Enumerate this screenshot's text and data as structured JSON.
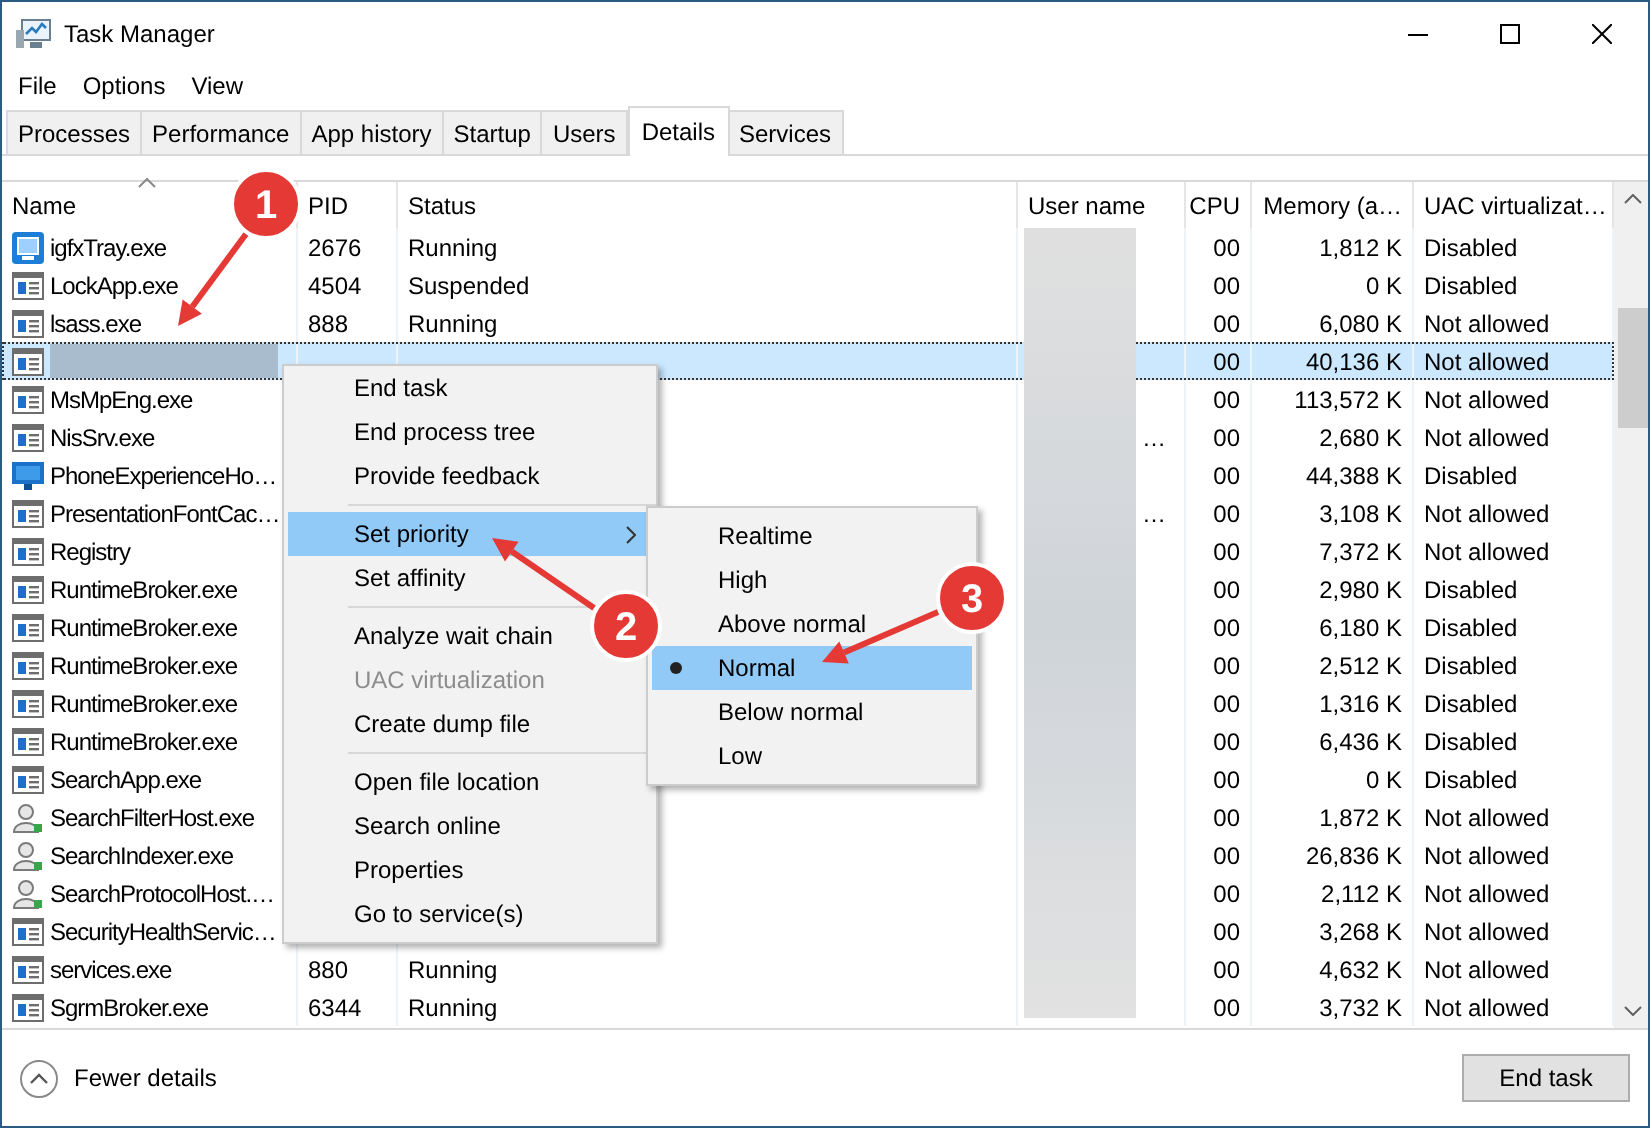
{
  "window": {
    "title": "Task Manager"
  },
  "menu_bar": [
    "File",
    "Options",
    "View"
  ],
  "tabs": [
    {
      "label": "Processes",
      "selected": false
    },
    {
      "label": "Performance",
      "selected": false
    },
    {
      "label": "App history",
      "selected": false
    },
    {
      "label": "Startup",
      "selected": false
    },
    {
      "label": "Users",
      "selected": false
    },
    {
      "label": "Details",
      "selected": true
    },
    {
      "label": "Services",
      "selected": false
    }
  ],
  "table": {
    "columns": [
      "Name",
      "PID",
      "Status",
      "User name",
      "CPU",
      "Memory (a…",
      "UAC virtualizat…"
    ],
    "rows": [
      {
        "kind": "intel",
        "name": "igfxTray.exe",
        "pid": "2676",
        "status": "Running",
        "cpu": "00",
        "memory": "1,812 K",
        "uac": "Disabled",
        "selected": false
      },
      {
        "kind": "app",
        "name": "LockApp.exe",
        "pid": "4504",
        "status": "Suspended",
        "cpu": "00",
        "memory": "0 K",
        "uac": "Disabled",
        "selected": false
      },
      {
        "kind": "app",
        "name": "lsass.exe",
        "pid": "888",
        "status": "Running",
        "cpu": "00",
        "memory": "6,080 K",
        "uac": "Not allowed",
        "selected": false
      },
      {
        "kind": "app",
        "cpu": "00",
        "memory": "40,136 K",
        "uac": "Not allowed",
        "selected": true
      },
      {
        "kind": "app",
        "name": "MsMpEng.exe",
        "cpu": "00",
        "memory": "113,572 K",
        "uac": "Not allowed",
        "selected": false
      },
      {
        "kind": "app",
        "name": "NisSrv.exe",
        "user_name": "…",
        "cpu": "00",
        "memory": "2,680 K",
        "uac": "Not allowed",
        "selected": false
      },
      {
        "kind": "phone",
        "name": "PhoneExperienceHo…",
        "cpu": "00",
        "memory": "44,388 K",
        "uac": "Disabled",
        "selected": false
      },
      {
        "kind": "app",
        "name": "PresentationFontCac…",
        "user_name": "…",
        "cpu": "00",
        "memory": "3,108 K",
        "uac": "Not allowed",
        "selected": false
      },
      {
        "kind": "app",
        "name": "Registry",
        "cpu": "00",
        "memory": "7,372 K",
        "uac": "Not allowed",
        "selected": false
      },
      {
        "kind": "app",
        "name": "RuntimeBroker.exe",
        "cpu": "00",
        "memory": "2,980 K",
        "uac": "Disabled",
        "selected": false
      },
      {
        "kind": "app",
        "name": "RuntimeBroker.exe",
        "cpu": "00",
        "memory": "6,180 K",
        "uac": "Disabled",
        "selected": false
      },
      {
        "kind": "app",
        "name": "RuntimeBroker.exe",
        "cpu": "00",
        "memory": "2,512 K",
        "uac": "Disabled",
        "selected": false
      },
      {
        "kind": "app",
        "name": "RuntimeBroker.exe",
        "cpu": "00",
        "memory": "1,316 K",
        "uac": "Disabled",
        "selected": false
      },
      {
        "kind": "app",
        "name": "RuntimeBroker.exe",
        "cpu": "00",
        "memory": "6,436 K",
        "uac": "Disabled",
        "selected": false
      },
      {
        "kind": "app",
        "name": "SearchApp.exe",
        "cpu": "00",
        "memory": "0 K",
        "uac": "Disabled",
        "selected": false
      },
      {
        "kind": "search",
        "name": "SearchFilterHost.exe",
        "cpu": "00",
        "memory": "1,872 K",
        "uac": "Not allowed",
        "selected": false
      },
      {
        "kind": "search",
        "name": "SearchIndexer.exe",
        "cpu": "00",
        "memory": "26,836 K",
        "uac": "Not allowed",
        "selected": false
      },
      {
        "kind": "search",
        "name": "SearchProtocolHost.…",
        "cpu": "00",
        "memory": "2,112 K",
        "uac": "Not allowed",
        "selected": false
      },
      {
        "kind": "app",
        "name": "SecurityHealthServic…",
        "cpu": "00",
        "memory": "3,268 K",
        "uac": "Not allowed",
        "selected": false
      },
      {
        "kind": "app",
        "name": "services.exe",
        "pid": "880",
        "status": "Running",
        "cpu": "00",
        "memory": "4,632 K",
        "uac": "Not allowed",
        "selected": false
      },
      {
        "kind": "app",
        "name": "SgrmBroker.exe",
        "pid": "6344",
        "status": "Running",
        "cpu": "00",
        "memory": "3,732 K",
        "uac": "Not allowed",
        "selected": false
      }
    ]
  },
  "context_menu": {
    "groups": [
      {
        "items": [
          {
            "label": "End task",
            "selected": false,
            "disabled": false
          },
          {
            "label": "End process tree",
            "selected": false,
            "disabled": false
          },
          {
            "label": "Provide feedback",
            "selected": false,
            "disabled": false
          }
        ]
      },
      {
        "items": [
          {
            "label": "Set priority",
            "selected": true,
            "disabled": false,
            "submenu": true
          },
          {
            "label": "Set affinity",
            "selected": false,
            "disabled": false
          }
        ]
      },
      {
        "items": [
          {
            "label": "Analyze wait chain",
            "selected": false,
            "disabled": false
          },
          {
            "label": "UAC virtualization",
            "selected": false,
            "disabled": true
          },
          {
            "label": "Create dump file",
            "selected": false,
            "disabled": false
          }
        ]
      },
      {
        "items": [
          {
            "label": "Open file location",
            "selected": false,
            "disabled": false
          },
          {
            "label": "Search online",
            "selected": false,
            "disabled": false
          },
          {
            "label": "Properties",
            "selected": false,
            "disabled": false
          },
          {
            "label": "Go to service(s)",
            "selected": false,
            "disabled": false
          }
        ]
      }
    ]
  },
  "priority_submenu": {
    "items": [
      {
        "label": "Realtime",
        "selected": false,
        "checked": false
      },
      {
        "label": "High",
        "selected": false,
        "checked": false
      },
      {
        "label": "Above normal",
        "selected": false,
        "checked": false
      },
      {
        "label": "Normal",
        "selected": true,
        "checked": true
      },
      {
        "label": "Below normal",
        "selected": false,
        "checked": false
      },
      {
        "label": "Low",
        "selected": false,
        "checked": false
      }
    ]
  },
  "annotations": [
    {
      "label": "1"
    },
    {
      "label": "2"
    },
    {
      "label": "3"
    }
  ],
  "footer": {
    "toggle": "Fewer details",
    "button": "End task"
  }
}
